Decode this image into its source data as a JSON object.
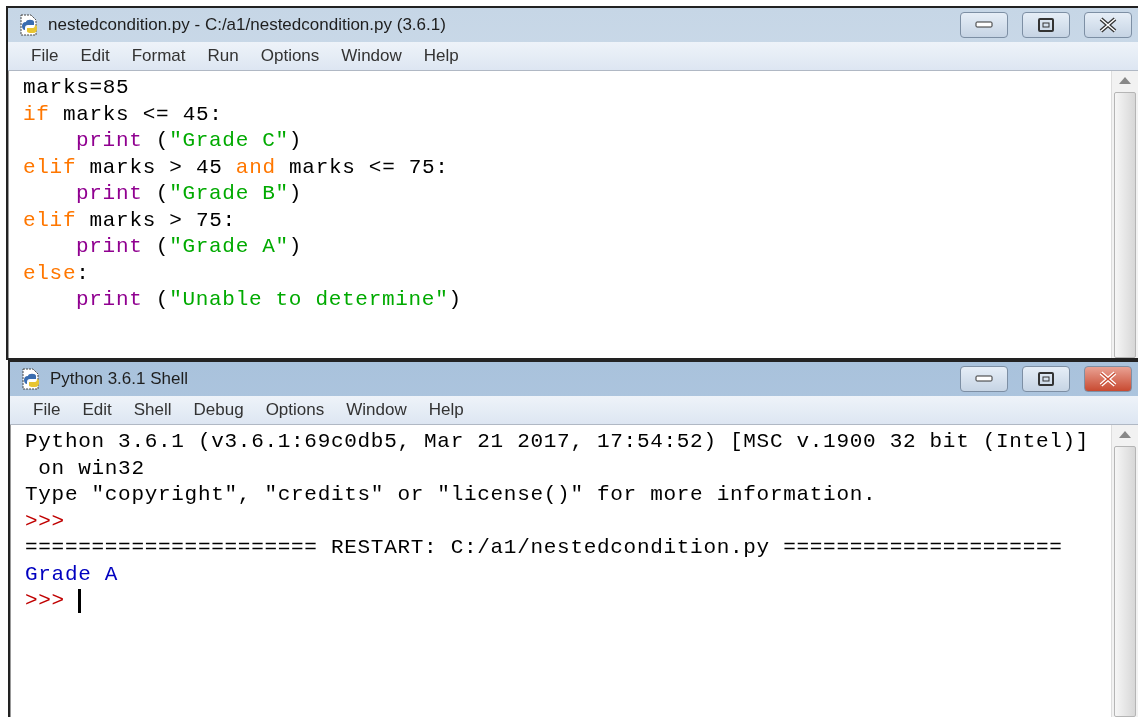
{
  "editor": {
    "title": "nestedcondition.py - C:/a1/nestedcondition.py (3.6.1)",
    "active": false,
    "menu": [
      "File",
      "Edit",
      "Format",
      "Run",
      "Options",
      "Window",
      "Help"
    ],
    "lines": [
      {
        "indent": false,
        "tokens": [
          {
            "kind": "plain",
            "text": "marks=85"
          }
        ]
      },
      {
        "indent": false,
        "tokens": [
          {
            "kind": "keyword",
            "text": "if"
          },
          {
            "kind": "plain",
            "text": " marks <= 45:"
          }
        ]
      },
      {
        "indent": true,
        "tokens": [
          {
            "kind": "builtin",
            "text": "print"
          },
          {
            "kind": "plain",
            "text": " ("
          },
          {
            "kind": "string",
            "text": "\"Grade C\""
          },
          {
            "kind": "plain",
            "text": ")"
          }
        ]
      },
      {
        "indent": false,
        "tokens": [
          {
            "kind": "keyword",
            "text": "elif"
          },
          {
            "kind": "plain",
            "text": " marks > 45 "
          },
          {
            "kind": "keyword",
            "text": "and"
          },
          {
            "kind": "plain",
            "text": " marks <= 75:"
          }
        ]
      },
      {
        "indent": true,
        "tokens": [
          {
            "kind": "builtin",
            "text": "print"
          },
          {
            "kind": "plain",
            "text": " ("
          },
          {
            "kind": "string",
            "text": "\"Grade B\""
          },
          {
            "kind": "plain",
            "text": ")"
          }
        ]
      },
      {
        "indent": false,
        "tokens": [
          {
            "kind": "keyword",
            "text": "elif"
          },
          {
            "kind": "plain",
            "text": " marks > 75:"
          }
        ]
      },
      {
        "indent": true,
        "tokens": [
          {
            "kind": "builtin",
            "text": "print"
          },
          {
            "kind": "plain",
            "text": " ("
          },
          {
            "kind": "string",
            "text": "\"Grade A\""
          },
          {
            "kind": "plain",
            "text": ")"
          }
        ]
      },
      {
        "indent": false,
        "tokens": [
          {
            "kind": "keyword",
            "text": "else"
          },
          {
            "kind": "plain",
            "text": ":"
          }
        ]
      },
      {
        "indent": true,
        "tokens": [
          {
            "kind": "builtin",
            "text": "print"
          },
          {
            "kind": "plain",
            "text": " ("
          },
          {
            "kind": "string",
            "text": "\"Unable to determine\""
          },
          {
            "kind": "plain",
            "text": ")"
          }
        ]
      }
    ]
  },
  "shell": {
    "title": "Python 3.6.1 Shell",
    "active": true,
    "menu": [
      "File",
      "Edit",
      "Shell",
      "Debug",
      "Options",
      "Window",
      "Help"
    ],
    "lines": [
      {
        "kind": "output",
        "text": "Python 3.6.1 (v3.6.1:69c0db5, Mar 21 2017, 17:54:52) [MSC v.1900 32 bit (Intel)]"
      },
      {
        "kind": "output",
        "text": " on win32"
      },
      {
        "kind": "output",
        "text": "Type \"copyright\", \"credits\" or \"license()\" for more information."
      },
      {
        "kind": "prompt",
        "text": ">>>"
      },
      {
        "kind": "output",
        "text": "====================== RESTART: C:/a1/nestedcondition.py ====================="
      },
      {
        "kind": "result",
        "text": "Grade A"
      },
      {
        "kind": "prompt",
        "text": ">>>",
        "cursor": true
      }
    ]
  }
}
